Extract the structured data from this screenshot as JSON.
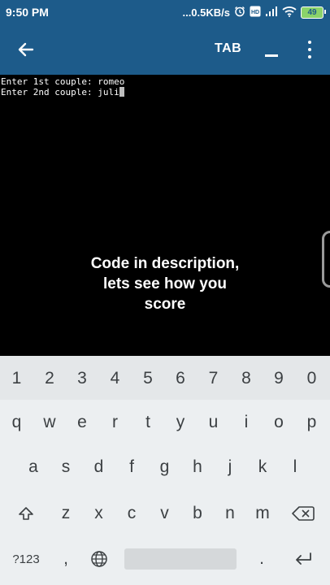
{
  "status_bar": {
    "time": "9:50 PM",
    "network_speed": "...0.5KB/s",
    "battery_level": "49",
    "icons": [
      "alarm-icon",
      "volte-icon",
      "cell-signal-icon",
      "wifi-icon",
      "battery-icon"
    ]
  },
  "app_bar": {
    "tab_label": "TAB",
    "icons": [
      "back-arrow-icon",
      "underscore-key-icon",
      "more-vert-icon"
    ],
    "color": "#1d5b8a"
  },
  "terminal": {
    "line1": "Enter 1st couple: romeo",
    "line2": "Enter 2nd couple: juli",
    "background": "#000000"
  },
  "overlay": {
    "text": "Code in description, lets see how you score"
  },
  "keyboard": {
    "number_row": [
      "1",
      "2",
      "3",
      "4",
      "5",
      "6",
      "7",
      "8",
      "9",
      "0"
    ],
    "row1": [
      "q",
      "w",
      "e",
      "r",
      "t",
      "y",
      "u",
      "i",
      "o",
      "p"
    ],
    "row2": [
      "a",
      "s",
      "d",
      "f",
      "g",
      "h",
      "j",
      "k",
      "l"
    ],
    "row3": [
      "z",
      "x",
      "c",
      "v",
      "b",
      "n",
      "m"
    ],
    "symbols_label": "?123",
    "comma_label": ",",
    "period_label": ".",
    "icons": [
      "shift-icon",
      "backspace-icon",
      "globe-icon",
      "enter-icon"
    ]
  }
}
